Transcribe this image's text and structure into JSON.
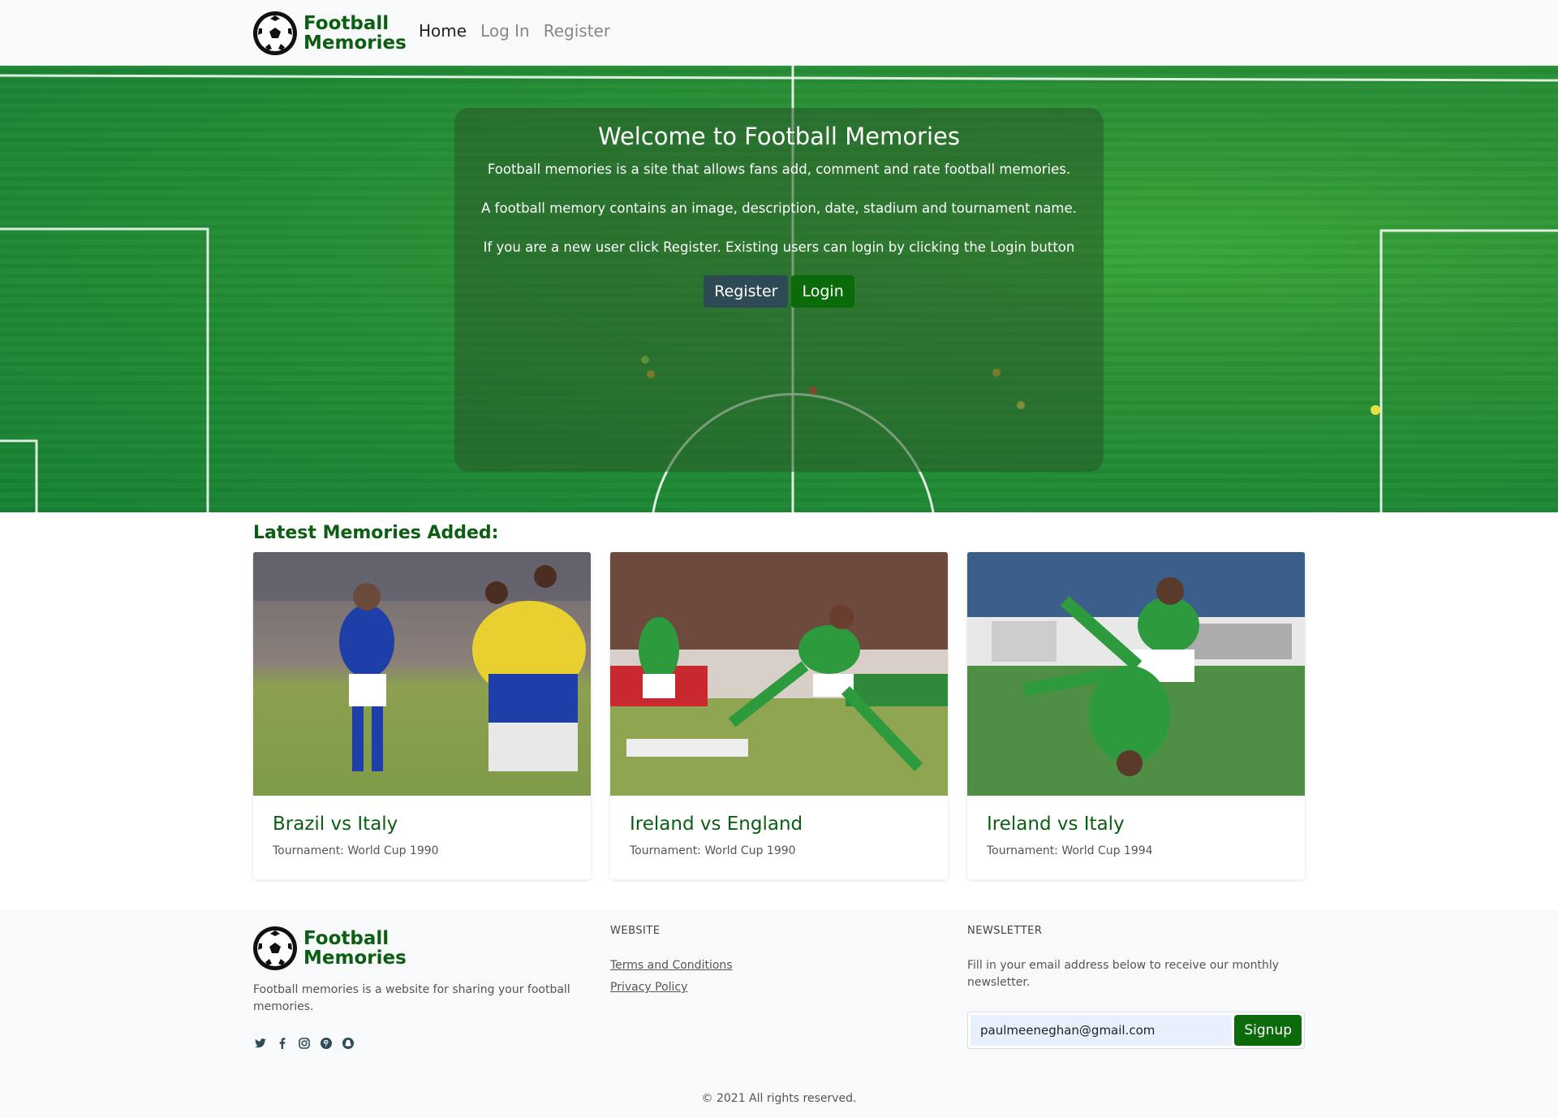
{
  "brand": {
    "line1": "Football",
    "line2": "Memories"
  },
  "nav": {
    "home": "Home",
    "login": "Log In",
    "register": "Register"
  },
  "hero": {
    "title": "Welcome to Football Memories",
    "p1": "Football memories is a site that allows fans add, comment and rate football memories.",
    "p2": "A football memory contains an image, description, date, stadium and tournament name.",
    "p3": "If you are a new user click Register. Existing users can login by clicking the Login button",
    "register_btn": "Register",
    "login_btn": "Login"
  },
  "latest": {
    "title": "Latest Memories Added:",
    "cards": [
      {
        "title": "Brazil vs Italy",
        "tournament": "Tournament: World Cup 1990"
      },
      {
        "title": "Ireland vs England",
        "tournament": "Tournament: World Cup 1990"
      },
      {
        "title": "Ireland vs Italy",
        "tournament": "Tournament: World Cup 1994"
      }
    ]
  },
  "footer": {
    "description": "Football memories is a website for sharing your football memories.",
    "social_icons": [
      "twitter-icon",
      "facebook-icon",
      "instagram-icon",
      "pinterest-icon",
      "snapchat-icon"
    ],
    "website_heading": "WEBSITE",
    "terms": "Terms and Conditions",
    "privacy": "Privacy Policy",
    "newsletter_heading": "NEWSLETTER",
    "newsletter_text": "Fill in your email address below to receive our monthly newsletter.",
    "email_value": "paulmeeneghan@gmail.com",
    "signup_btn": "Signup",
    "copyright": "© 2021 All rights reserved."
  },
  "colors": {
    "brand_green": "#0b5e12",
    "button_green": "#0b6b0b",
    "button_dark": "#2e4a55"
  }
}
